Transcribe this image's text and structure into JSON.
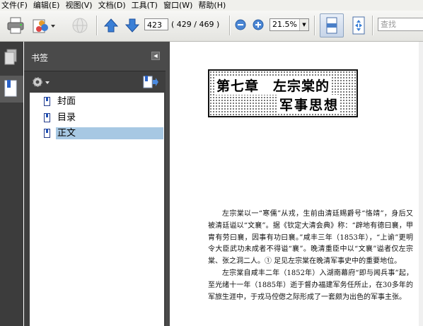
{
  "menu": [
    "文件(F)",
    "编辑(E)",
    "视图(V)",
    "文档(D)",
    "工具(T)",
    "窗口(W)",
    "帮助(H)"
  ],
  "toolbar": {
    "current_page": "423",
    "page_count": "( 429 / 469 )",
    "zoom": "21.5%",
    "search_placeholder": "查找"
  },
  "panel": {
    "title": "书签",
    "bookmarks": [
      {
        "label": "封面",
        "selected": false
      },
      {
        "label": "目录",
        "selected": false
      },
      {
        "label": "正文",
        "selected": true
      }
    ]
  },
  "document": {
    "chapter_line1": "第七章　左宗棠的",
    "chapter_line2": "军事思想",
    "paragraphs": [
      "左宗棠以一“寒儒”从戎，生前由清廷赐爵号“恪靖”，身后又被清廷谥以“文襄”。据《钦定大清会典》称：“辟地有德曰襄，甲胄有劳曰襄，因事有功曰襄。”咸丰三年（1853年），“上谕”更明令大臣武功未成者不得谥“襄”。晚清重臣中以“文襄”谥者仅左宗棠、张之洞二人。① 足见左宗棠在晚清军事史中的重要地位。",
      "左宗棠自咸丰二年（1852年）入湖南幕府“即与闻兵事”起，至光绪十一年（1885年）逝于督办福建军务任所止，在30多年的军旅生涯中，于戎马倥偬之际形成了一套颇为出色的军事主张。"
    ]
  },
  "colors": {
    "panel_bg": "#3f3f3f",
    "selection": "#a7c8e3",
    "nav_arrow": "#2a6fc9"
  }
}
